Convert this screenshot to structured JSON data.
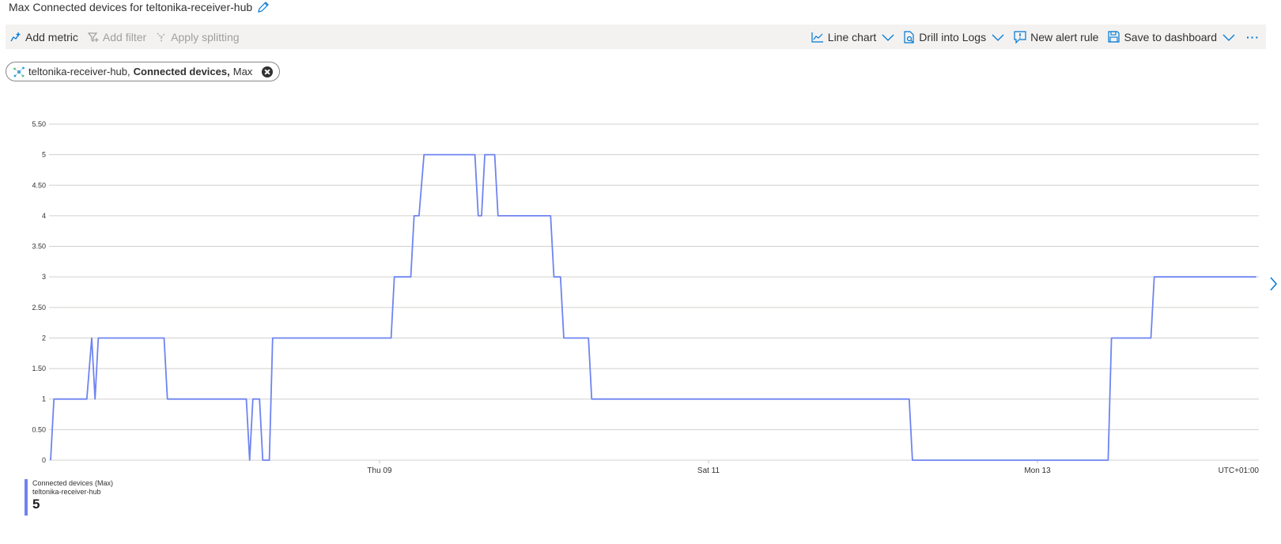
{
  "title": "Max Connected devices for teltonika-receiver-hub",
  "toolbar": {
    "left": [
      {
        "label": "Add metric",
        "icon": "add-metric-icon",
        "enabled": true
      },
      {
        "label": "Add filter",
        "icon": "add-filter-icon",
        "enabled": false
      },
      {
        "label": "Apply splitting",
        "icon": "apply-splitting-icon",
        "enabled": false
      }
    ],
    "right": [
      {
        "label": "Line chart",
        "icon": "line-chart-icon",
        "dropdown": true
      },
      {
        "label": "Drill into Logs",
        "icon": "drill-logs-icon",
        "dropdown": true
      },
      {
        "label": "New alert rule",
        "icon": "alert-icon",
        "dropdown": false
      },
      {
        "label": "Save to dashboard",
        "icon": "save-icon",
        "dropdown": true
      }
    ],
    "more": "···"
  },
  "metric_pill": {
    "resource": "teltonika-receiver-hub,",
    "metric": "Connected devices,",
    "aggregation": "Max"
  },
  "legend": {
    "name": "Connected devices (Max)",
    "resource": "teltonika-receiver-hub",
    "value": "5"
  },
  "colors": {
    "series": "#6e84f0",
    "toolbar_bg": "#f3f2f1",
    "accent": "#0078d4"
  },
  "chart_data": {
    "type": "line",
    "y_tick_labels": [
      "0",
      "0.50",
      "1",
      "1.50",
      "2",
      "2.50",
      "3",
      "3.50",
      "4",
      "4.50",
      "5",
      "5.50"
    ],
    "ylim": [
      0,
      5.5
    ],
    "x_tick_labels": [
      {
        "label": "Thu 09",
        "day": 2
      },
      {
        "label": "Sat 11",
        "day": 4
      },
      {
        "label": "Mon 13",
        "day": 6
      }
    ],
    "timezone_label": "UTC+01:00",
    "grid": true,
    "xlim_days": [
      0,
      7.33
    ],
    "series": [
      {
        "name": "Connected devices (Max)",
        "points": [
          [
            0.0,
            0
          ],
          [
            0.02,
            1
          ],
          [
            0.22,
            1
          ],
          [
            0.25,
            2
          ],
          [
            0.27,
            1
          ],
          [
            0.29,
            2
          ],
          [
            0.69,
            2
          ],
          [
            0.71,
            1
          ],
          [
            1.19,
            1
          ],
          [
            1.21,
            0
          ],
          [
            1.23,
            1
          ],
          [
            1.27,
            1
          ],
          [
            1.29,
            0
          ],
          [
            1.33,
            0
          ],
          [
            1.35,
            2
          ],
          [
            2.07,
            2
          ],
          [
            2.09,
            3
          ],
          [
            2.19,
            3
          ],
          [
            2.21,
            4
          ],
          [
            2.24,
            4
          ],
          [
            2.27,
            5
          ],
          [
            2.58,
            5
          ],
          [
            2.6,
            4
          ],
          [
            2.62,
            4
          ],
          [
            2.64,
            5
          ],
          [
            2.7,
            5
          ],
          [
            2.72,
            4
          ],
          [
            3.04,
            4
          ],
          [
            3.06,
            3
          ],
          [
            3.1,
            3
          ],
          [
            3.12,
            2
          ],
          [
            3.27,
            2
          ],
          [
            3.29,
            1
          ],
          [
            5.22,
            1
          ],
          [
            5.24,
            0
          ],
          [
            6.43,
            0
          ],
          [
            6.45,
            2
          ],
          [
            6.69,
            2
          ],
          [
            6.71,
            3
          ],
          [
            7.33,
            3
          ]
        ]
      }
    ]
  }
}
